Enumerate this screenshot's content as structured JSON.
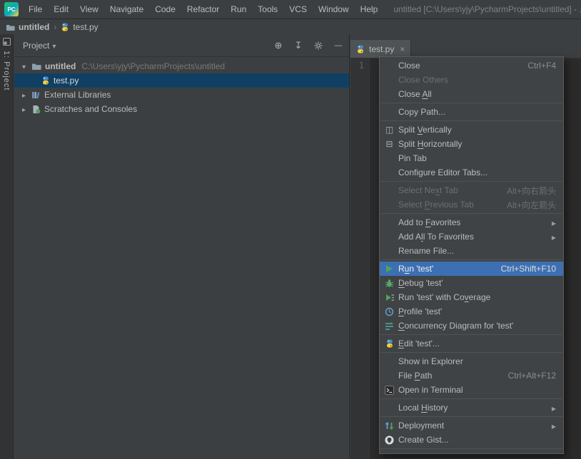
{
  "titlebar": {
    "logo_text": "PC",
    "menus": [
      "File",
      "Edit",
      "View",
      "Navigate",
      "Code",
      "Refactor",
      "Run",
      "Tools",
      "VCS",
      "Window",
      "Help"
    ],
    "window_title": "untitled [C:\\Users\\yjy\\PycharmProjects\\untitled] - ..."
  },
  "breadcrumb": {
    "project": "untitled",
    "separator": "›",
    "file": "test.py"
  },
  "tool_stripe": {
    "project_button": "1: Project"
  },
  "project_panel": {
    "title": "Project",
    "toolbar_icons": [
      "locate-icon",
      "collapse-all-icon",
      "settings-gear-icon",
      "hide-panel-icon"
    ],
    "tree": [
      {
        "label": "untitled",
        "path": "C:\\Users\\yjy\\PycharmProjects\\untitled"
      },
      {
        "label": "test.py"
      },
      {
        "label": "External Libraries"
      },
      {
        "label": "Scratches and Consoles"
      }
    ]
  },
  "editor": {
    "tab_label": "test.py",
    "gutter_line": "1"
  },
  "context_menu": {
    "items": [
      {
        "label": "Close",
        "shortcut": "Ctrl+F4"
      },
      {
        "label": "Close Others",
        "state": "disabled"
      },
      {
        "label": "Close All",
        "mnemonic": "A"
      },
      {
        "label": "Copy Path..."
      },
      {
        "label": "Split Vertically",
        "mnemonic": "V",
        "icon": "split-vertical-icon"
      },
      {
        "label": "Split Horizontally",
        "mnemonic": "H",
        "icon": "split-horizontal-icon"
      },
      {
        "label": "Pin Tab"
      },
      {
        "label": "Configure Editor Tabs..."
      },
      {
        "label": "Select Next Tab",
        "mnemonic": "x",
        "state": "disabled",
        "shortcut": "Alt+向右箭头"
      },
      {
        "label": "Select Previous Tab",
        "mnemonic": "P",
        "state": "disabled",
        "shortcut": "Alt+向左箭头"
      },
      {
        "label": "Add to Favorites",
        "mnemonic": "F",
        "submenu": true
      },
      {
        "label": "Add All To Favorites",
        "mnemonic": "l",
        "submenu": true
      },
      {
        "label": "Rename File..."
      },
      {
        "label": "Run 'test'",
        "mnemonic": "u",
        "state": "highlighted",
        "icon": "run-icon",
        "shortcut": "Ctrl+Shift+F10"
      },
      {
        "label": "Debug 'test'",
        "mnemonic": "D",
        "icon": "debug-icon"
      },
      {
        "label": "Run 'test' with Coverage",
        "mnemonic": "v",
        "icon": "coverage-icon"
      },
      {
        "label": "Profile 'test'",
        "mnemonic": "P",
        "icon": "profile-icon"
      },
      {
        "label": "Concurrency Diagram for 'test'",
        "mnemonic": "C",
        "icon": "concurrency-icon"
      },
      {
        "label": "Edit 'test'...",
        "mnemonic": "E",
        "icon": "python-icon"
      },
      {
        "label": "Show in Explorer"
      },
      {
        "label": "File Path",
        "mnemonic": "P",
        "shortcut": "Ctrl+Alt+F12"
      },
      {
        "label": "Open in Terminal",
        "icon": "terminal-icon"
      },
      {
        "label": "Local History",
        "mnemonic": "H",
        "submenu": true
      },
      {
        "label": "Deployment",
        "icon": "deployment-icon",
        "submenu": true
      },
      {
        "label": "Create Gist...",
        "icon": "gist-icon"
      }
    ]
  }
}
